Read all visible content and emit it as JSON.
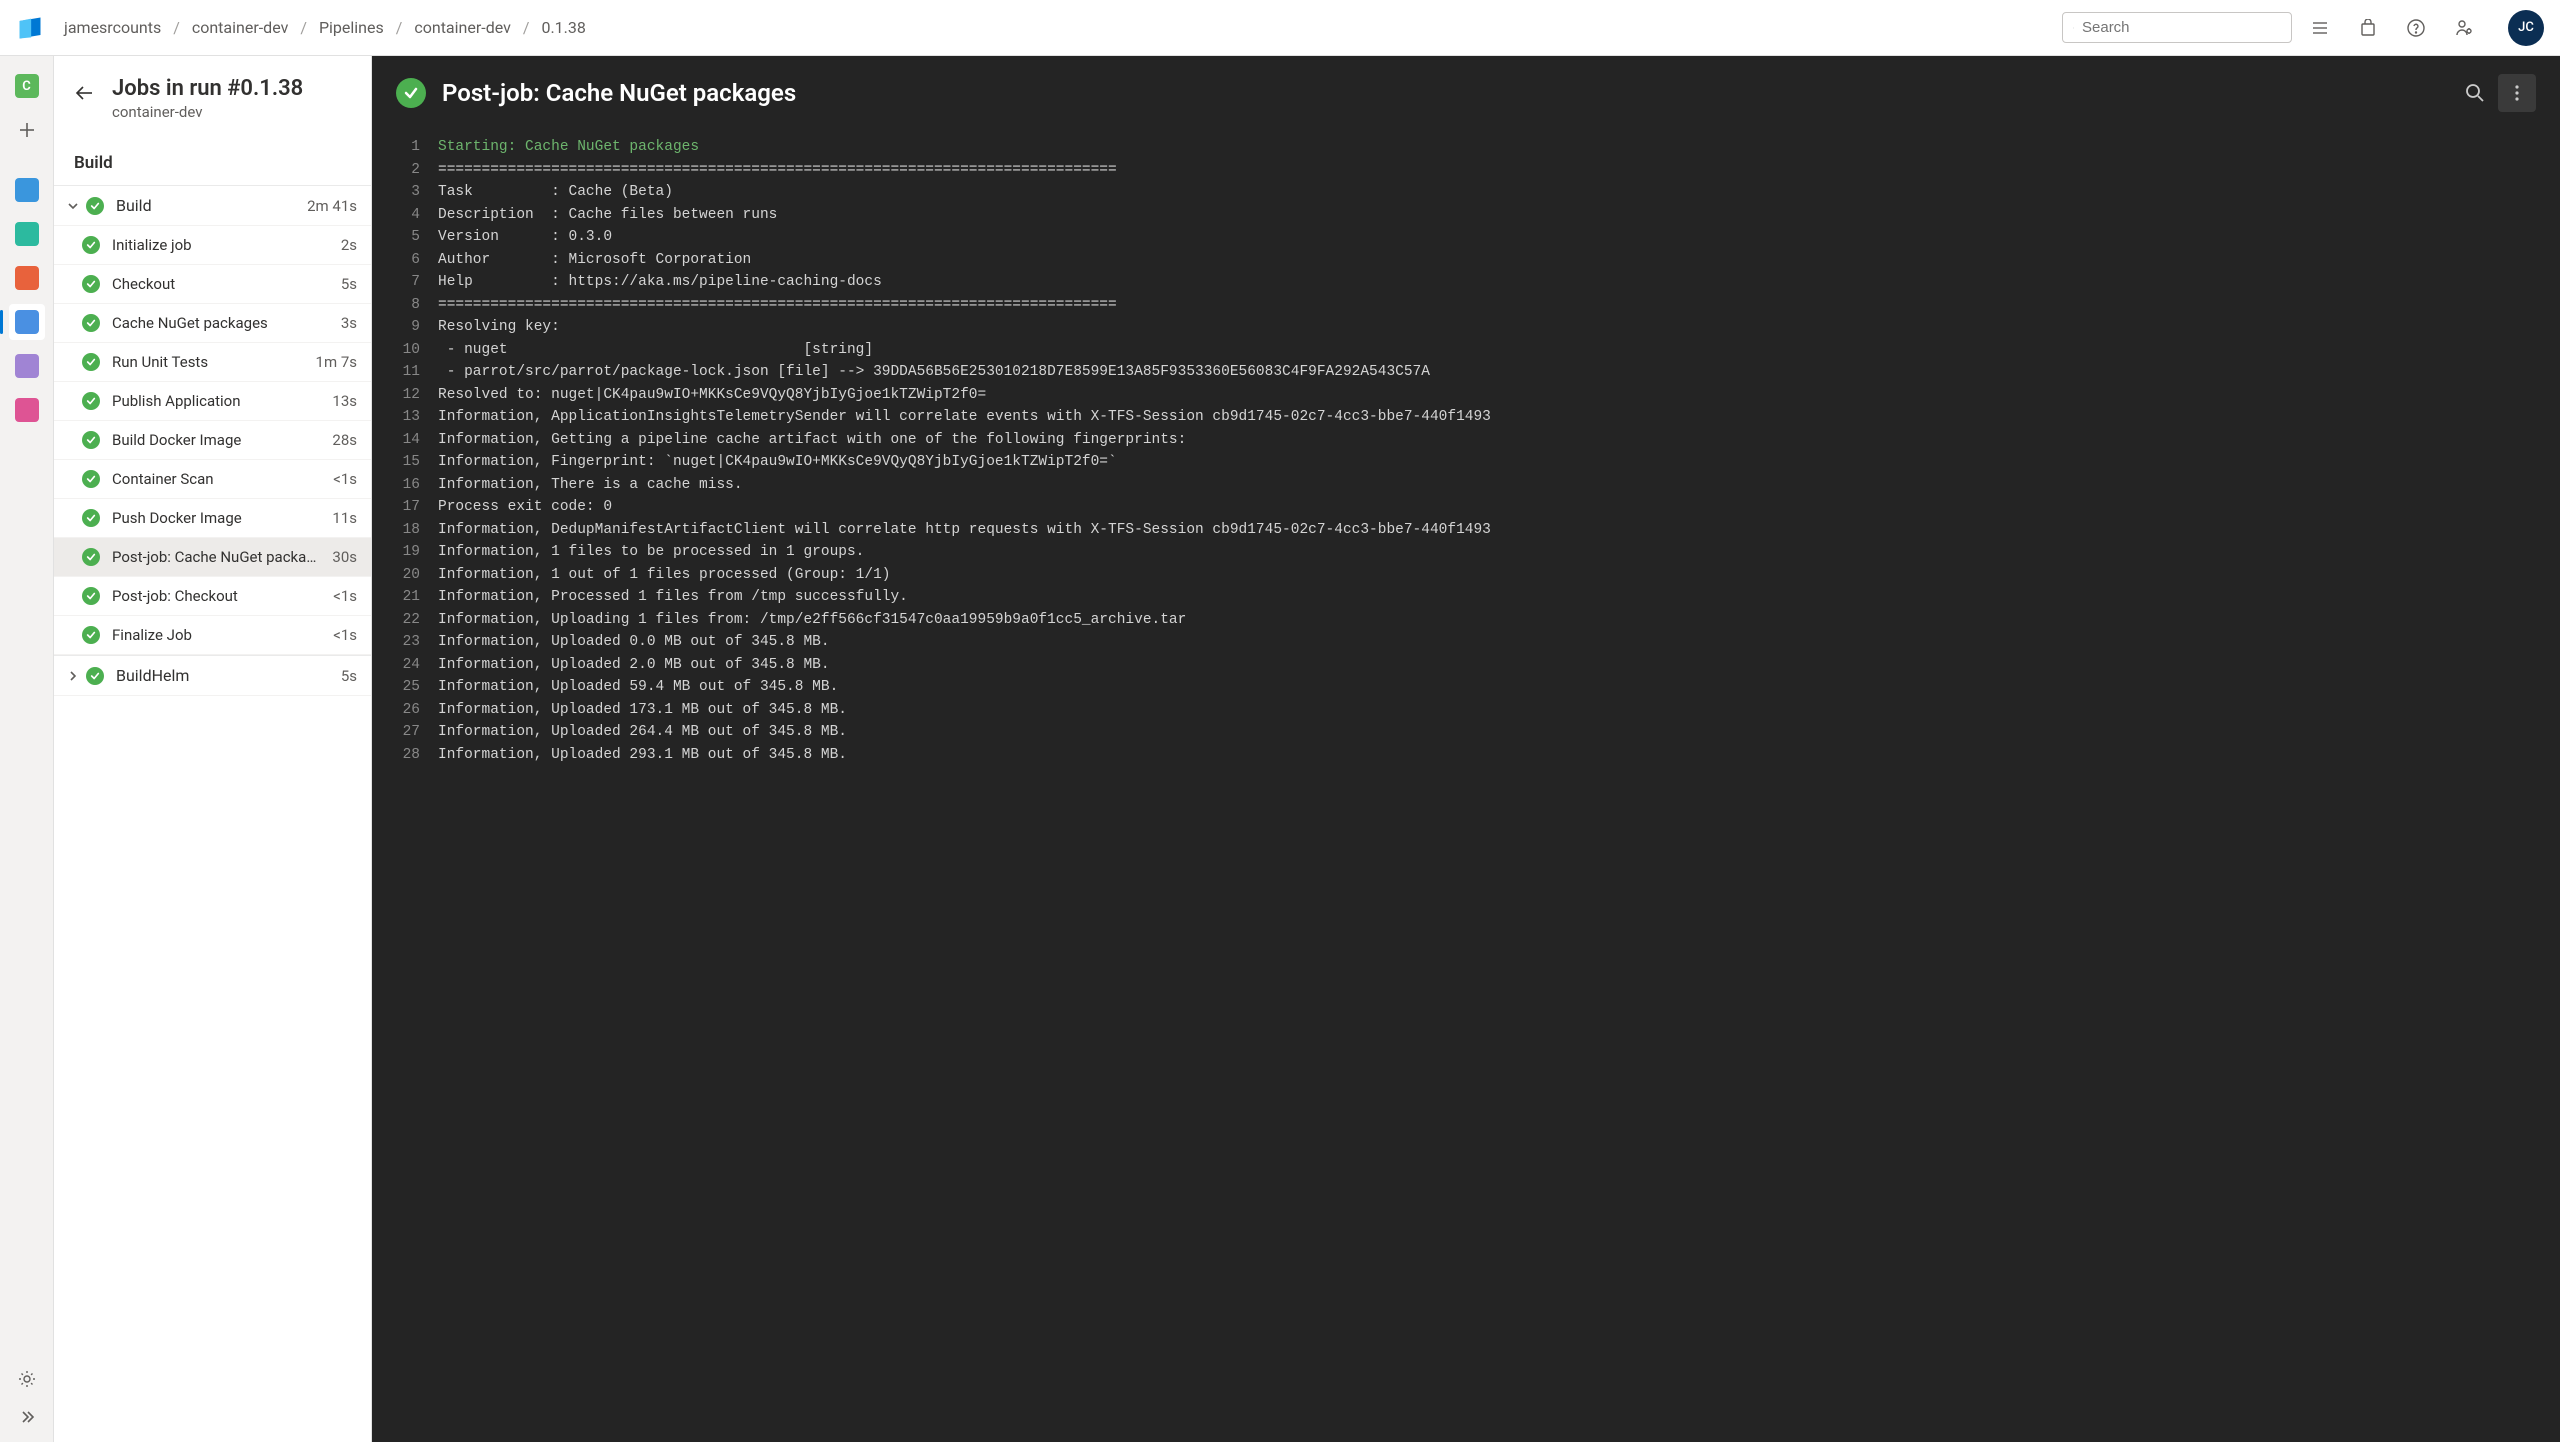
{
  "breadcrumbs": [
    "jamesrcounts",
    "container-dev",
    "Pipelines",
    "container-dev",
    "0.1.38"
  ],
  "search": {
    "placeholder": "Search"
  },
  "avatar": "JC",
  "sidebar": {
    "title": "Jobs in run #0.1.38",
    "subtitle": "container-dev",
    "stage_label": "Build",
    "jobs": [
      {
        "name": "Build",
        "duration": "2m 41s",
        "expanded": true,
        "steps": [
          {
            "name": "Initialize job",
            "duration": "2s"
          },
          {
            "name": "Checkout",
            "duration": "5s"
          },
          {
            "name": "Cache NuGet packages",
            "duration": "3s"
          },
          {
            "name": "Run Unit Tests",
            "duration": "1m 7s"
          },
          {
            "name": "Publish Application",
            "duration": "13s"
          },
          {
            "name": "Build Docker Image",
            "duration": "28s"
          },
          {
            "name": "Container Scan",
            "duration": "<1s"
          },
          {
            "name": "Push Docker Image",
            "duration": "11s"
          },
          {
            "name": "Post-job: Cache NuGet packages",
            "duration": "30s",
            "selected": true
          },
          {
            "name": "Post-job: Checkout",
            "duration": "<1s"
          },
          {
            "name": "Finalize Job",
            "duration": "<1s"
          }
        ]
      },
      {
        "name": "BuildHelm",
        "duration": "5s",
        "expanded": false,
        "steps": []
      }
    ]
  },
  "log": {
    "title": "Post-job: Cache NuGet packages",
    "lines": [
      {
        "n": 1,
        "t": "Starting: Cache NuGet packages",
        "c": "green"
      },
      {
        "n": 2,
        "t": "=============================================================================="
      },
      {
        "n": 3,
        "t": "Task         : Cache (Beta)"
      },
      {
        "n": 4,
        "t": "Description  : Cache files between runs"
      },
      {
        "n": 5,
        "t": "Version      : 0.3.0"
      },
      {
        "n": 6,
        "t": "Author       : Microsoft Corporation"
      },
      {
        "n": 7,
        "t": "Help         : https://aka.ms/pipeline-caching-docs"
      },
      {
        "n": 8,
        "t": "=============================================================================="
      },
      {
        "n": 9,
        "t": "Resolving key:"
      },
      {
        "n": 10,
        "t": " - nuget                                  [string]"
      },
      {
        "n": 11,
        "t": " - parrot/src/parrot/package-lock.json [file] --> 39DDA56B56E253010218D7E8599E13A85F9353360E56083C4F9FA292A543C57A"
      },
      {
        "n": 12,
        "t": "Resolved to: nuget|CK4pau9wIO+MKKsCe9VQyQ8YjbIyGjoe1kTZWipT2f0="
      },
      {
        "n": 13,
        "t": "Information, ApplicationInsightsTelemetrySender will correlate events with X-TFS-Session cb9d1745-02c7-4cc3-bbe7-440f1493"
      },
      {
        "n": 14,
        "t": "Information, Getting a pipeline cache artifact with one of the following fingerprints:"
      },
      {
        "n": 15,
        "t": "Information, Fingerprint: `nuget|CK4pau9wIO+MKKsCe9VQyQ8YjbIyGjoe1kTZWipT2f0=`"
      },
      {
        "n": 16,
        "t": "Information, There is a cache miss."
      },
      {
        "n": 17,
        "t": "Process exit code: 0"
      },
      {
        "n": 18,
        "t": "Information, DedupManifestArtifactClient will correlate http requests with X-TFS-Session cb9d1745-02c7-4cc3-bbe7-440f1493"
      },
      {
        "n": 19,
        "t": "Information, 1 files to be processed in 1 groups."
      },
      {
        "n": 20,
        "t": "Information, 1 out of 1 files processed (Group: 1/1)"
      },
      {
        "n": 21,
        "t": "Information, Processed 1 files from /tmp successfully."
      },
      {
        "n": 22,
        "t": "Information, Uploading 1 files from: /tmp/e2ff566cf31547c0aa19959b9a0f1cc5_archive.tar"
      },
      {
        "n": 23,
        "t": "Information, Uploaded 0.0 MB out of 345.8 MB."
      },
      {
        "n": 24,
        "t": "Information, Uploaded 2.0 MB out of 345.8 MB."
      },
      {
        "n": 25,
        "t": "Information, Uploaded 59.4 MB out of 345.8 MB."
      },
      {
        "n": 26,
        "t": "Information, Uploaded 173.1 MB out of 345.8 MB."
      },
      {
        "n": 27,
        "t": "Information, Uploaded 264.4 MB out of 345.8 MB."
      },
      {
        "n": 28,
        "t": "Information, Uploaded 293.1 MB out of 345.8 MB."
      }
    ]
  },
  "nav_colors": [
    "#5cb85c",
    "#ffffff",
    "#3a96dd",
    "#2cba9f",
    "#e8623c",
    "#4a90e2",
    "#a084d4",
    "#de5494"
  ]
}
